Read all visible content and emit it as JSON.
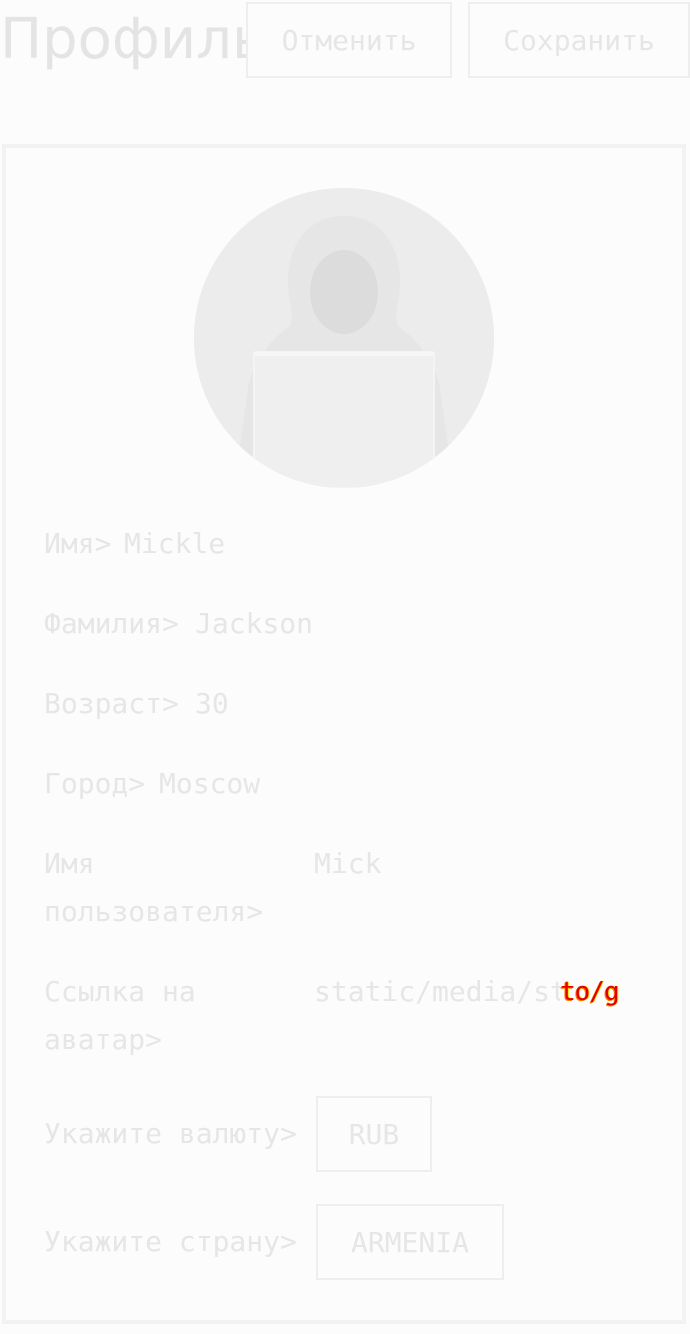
{
  "header": {
    "title": "Профиль",
    "cancel_label": "Отменить",
    "save_label": "Сохранить"
  },
  "profile": {
    "avatar_alt": "hooded figure with laptop",
    "fields": {
      "first_name": {
        "label": "Имя>",
        "value": "Mickle"
      },
      "last_name": {
        "label": "Фамилия>",
        "value": "Jackson"
      },
      "age": {
        "label": "Возраст>",
        "value": "30"
      },
      "city": {
        "label": "Город>",
        "value": "Moscow"
      },
      "username": {
        "label": "Имя пользователя>",
        "value": "Mick"
      },
      "avatar_link": {
        "label": "Ссылка на аватар>",
        "value": "static/media/st"
      },
      "currency": {
        "label": "Укажите валюту>",
        "value": "RUB"
      },
      "country": {
        "label": "Укажите страну>",
        "value": "ARMENIA"
      }
    },
    "overflow_glitch_text": "to/g"
  },
  "colors": {
    "background": "#fcfcfc",
    "text": "#e6e6e6",
    "border": "#eeeeee",
    "glitch_red": "#e10000",
    "glitch_yellow": "#ffd800"
  }
}
